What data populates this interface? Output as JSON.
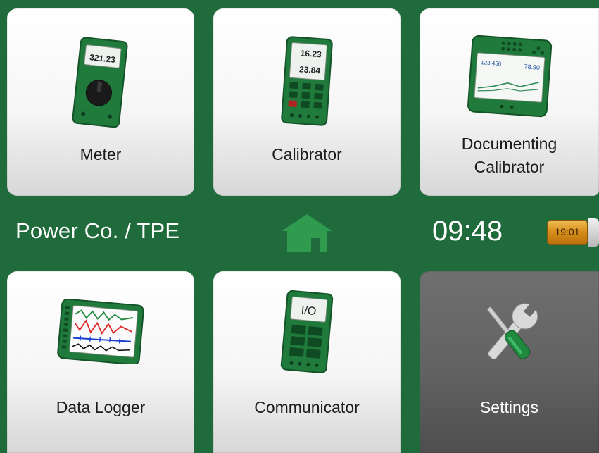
{
  "tiles": {
    "meter": {
      "label": "Meter",
      "display_value": "321.23"
    },
    "calibrator": {
      "label": "Calibrator",
      "display_top": "16.23",
      "display_bottom": "23.84"
    },
    "documenting_calibrator": {
      "label_line1": "Documenting",
      "label_line2": "Calibrator",
      "display_left": "123.456",
      "display_right": "78.90"
    },
    "data_logger": {
      "label": "Data Logger"
    },
    "communicator": {
      "label": "Communicator",
      "display_text": "I/O"
    },
    "settings": {
      "label": "Settings"
    }
  },
  "status_bar": {
    "location": "Power Co. / TPE",
    "time": "09:48",
    "battery_time": "19:01"
  },
  "icons": {
    "home": "home-icon",
    "settings": "wrench-screwdriver-icon"
  },
  "colors": {
    "brand_green": "#1f6b3c",
    "device_green": "#2a8a45",
    "battery_amber": "#d88f1a",
    "settings_tile": "#626262"
  }
}
